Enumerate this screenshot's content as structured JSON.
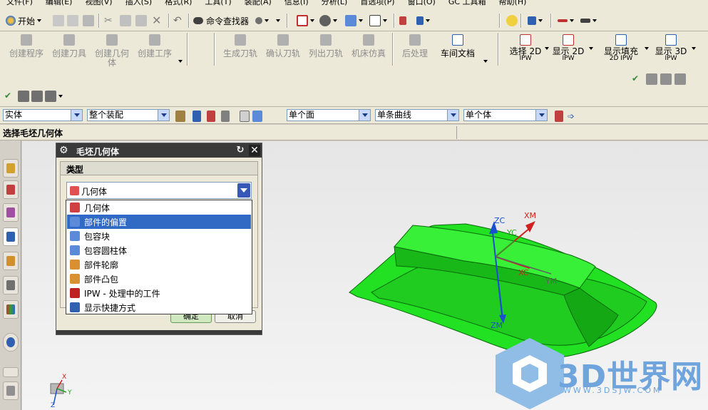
{
  "menu": [
    "文件(F)",
    "编辑(E)",
    "视图(V)",
    "插入(S)",
    "格式(R)",
    "工具(T)",
    "装配(A)",
    "信息(I)",
    "分析(L)",
    "首选项(P)",
    "窗口(O)",
    "GC 工具箱",
    "帮助(H)"
  ],
  "toolbar1": {
    "start_label": "开始",
    "command_finder_label": "命令查找器"
  },
  "cam_buttons": {
    "create_program": "创建程序",
    "create_tool": "创建刀具",
    "create_geometry_line1": "创建几何",
    "create_geometry_line2": "体",
    "create_operation": "创建工序",
    "generate_path": "生成刀轨",
    "verify_path": "确认刀轨",
    "list_path": "列出刀轨",
    "machine_sim": "机床仿真",
    "postprocess": "后处理",
    "shop_doc": "车间文档"
  },
  "ipw_buttons": {
    "select_2d": "选择 2D",
    "show_2d": "显示 2D",
    "show_fill": "显示填充",
    "show_3d": "显示 3D",
    "ipw": "IPW",
    "fill_ipw": "2D IPW"
  },
  "selection_bar": {
    "filter": "实体",
    "scope": "整个装配",
    "face_rule": "单个面",
    "curve_rule": "单条曲线",
    "body_rule": "单个体"
  },
  "cue_line": "选择毛坯几何体",
  "dialog": {
    "title": "毛坯几何体",
    "group_title": "类型",
    "type_value": "几何体",
    "ok": "确定",
    "cancel": "取消"
  },
  "dropdown_options": [
    {
      "label": "几何体",
      "selected": false,
      "color": "#d04040"
    },
    {
      "label": "部件的偏置",
      "selected": true,
      "color": "#5a8ad8"
    },
    {
      "label": "包容块",
      "selected": false,
      "color": "#5a8ad8"
    },
    {
      "label": "包容圆柱体",
      "selected": false,
      "color": "#5a8ad8"
    },
    {
      "label": "部件轮廓",
      "selected": false,
      "color": "#d89030"
    },
    {
      "label": "部件凸包",
      "selected": false,
      "color": "#d89030"
    },
    {
      "label": "IPW - 处理中的工件",
      "selected": false,
      "color": "#c02020"
    },
    {
      "label": "显示快捷方式",
      "selected": false,
      "color": "#3060b0"
    }
  ],
  "axes": {
    "zc": "ZC",
    "xm": "XM",
    "yc": "YC",
    "xc": "XC",
    "ym": "YM",
    "zm": "ZM",
    "triad_x": "X",
    "triad_y": "Y",
    "triad_z": "Z"
  },
  "watermark": {
    "brand": "3D世界网",
    "url": "WWW.3DSJW.COM"
  },
  "colors": {
    "part": "#22e022",
    "highlight": "#316ac5",
    "dialog_title_bg": "#3a3a3a"
  }
}
